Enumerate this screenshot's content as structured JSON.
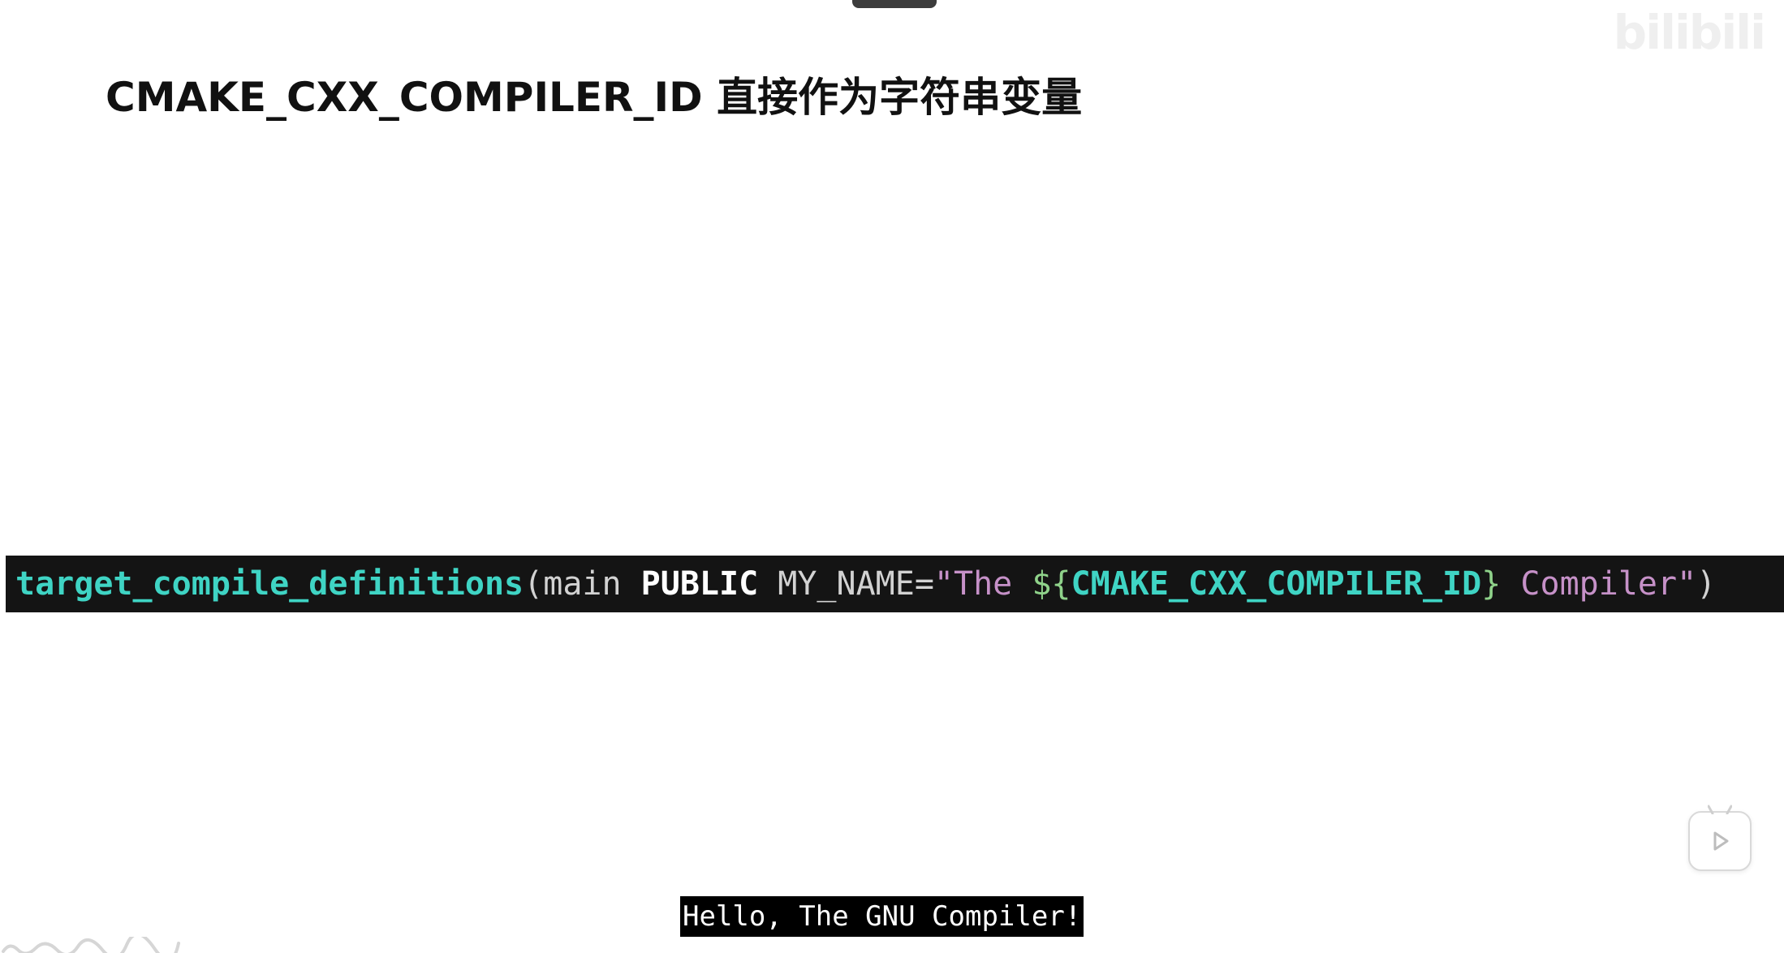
{
  "slide": {
    "title": "CMAKE_CXX_COMPILER_ID 直接作为字符串变量"
  },
  "watermark": {
    "text": "bilibili"
  },
  "code": {
    "func": "target_compile_definitions",
    "open_paren": "(",
    "arg_target": "main ",
    "arg_visibility": "PUBLIC",
    "define_name": " MY_NAME=",
    "string_start": "\"The ",
    "interp_open": "${",
    "variable": "CMAKE_CXX_COMPILER_ID",
    "interp_close": "}",
    "string_end": " Compiler\"",
    "close_paren": ")"
  },
  "output": {
    "text": "Hello, The GNU Compiler!"
  },
  "colors": {
    "background": "#ffffff",
    "code_bg": "#141414",
    "code_function": "#3fd4c4",
    "code_string": "#c691c8",
    "code_interpolation": "#8fd28a"
  },
  "icons": {
    "player": "bilibili-play-icon"
  }
}
